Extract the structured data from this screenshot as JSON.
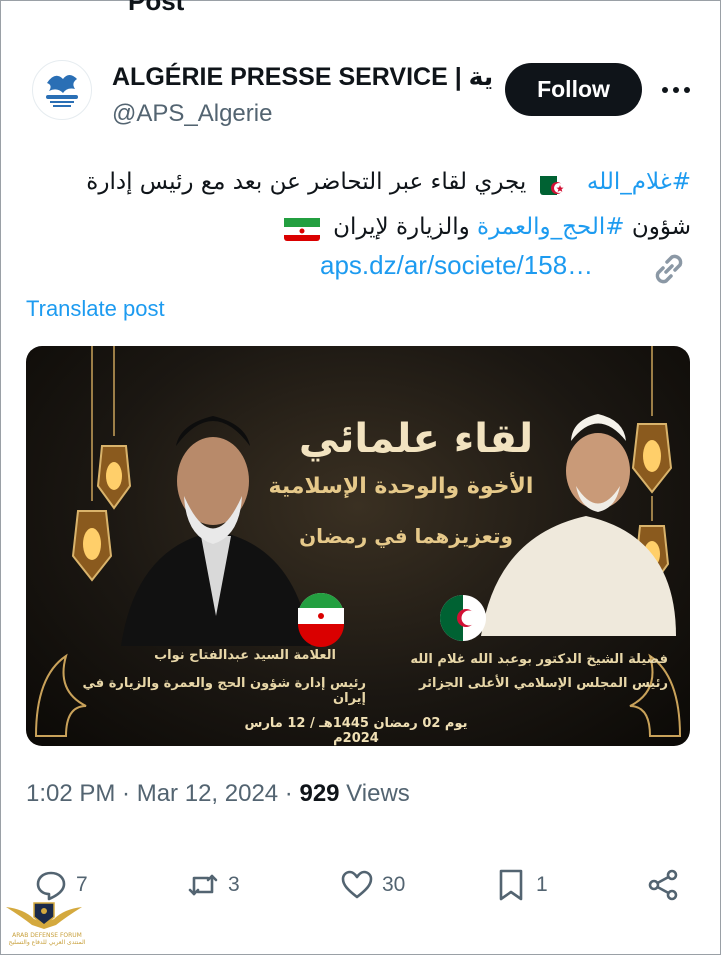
{
  "header": {
    "top_cut_text": "Post",
    "display_name": "ALGÉRIE PRESSE SERVICE | ية",
    "handle": "@APS_Algerie",
    "follow_label": "Follow",
    "more_label": "•••"
  },
  "tweet": {
    "hashtag1": "#غلام_الله",
    "text1": " يجري لقاء عبر التحاضر عن بعد مع رئيس إدارة شؤون ",
    "hashtag2": "#الحج_والعمرة",
    "text2": " والزيارة لإيران ",
    "link": "aps.dz/ar/societe/158…",
    "translate": "Translate post"
  },
  "media": {
    "title": "لقاء علمائي",
    "subtitle1": "الأخوة والوحدة الإسلامية",
    "subtitle2": "وتعزيزهما في رمضان",
    "left_name": "العلامة السيد عبدالفتاح نواب",
    "left_role": "رئيس إدارة شؤون الحج والعمرة والزيارة في إيران",
    "right_name": "فضيلة الشيخ الدكتور بوعبد الله غلام الله",
    "right_role": "رئيس المجلس الإسلامي الأعلى الجزائر",
    "date": "يوم 02 رمضان 1445هـ / 12 مارس 2024م"
  },
  "meta": {
    "time": "1:02 PM",
    "sep1": " · ",
    "date": "Mar 12, 2024",
    "sep2": " · ",
    "views_count": "929",
    "views_label": " Views"
  },
  "actions": {
    "replies": "7",
    "reposts": "3",
    "likes": "30",
    "bookmarks": "1"
  },
  "watermark": {
    "line1": "ARAB DEFENSE FORUM",
    "line2": "المنتدى العربي للدفاع والتسليح"
  },
  "colors": {
    "accent": "#1d9bf0",
    "text": "#0f1419",
    "muted": "#536471",
    "follow_bg": "#0f1419"
  },
  "icons": [
    "aps-logo-icon",
    "more-icon",
    "algeria-flag-icon",
    "iran-flag-icon",
    "link-icon",
    "reply-icon",
    "repost-icon",
    "like-icon",
    "bookmark-icon",
    "share-icon"
  ]
}
